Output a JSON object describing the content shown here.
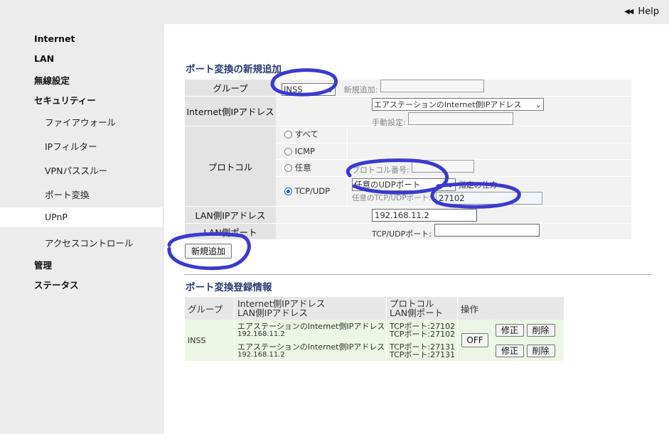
{
  "header": {
    "help_label": "Help",
    "help_arrows": "◀◀"
  },
  "sidebar": {
    "items": [
      {
        "label": "Internet"
      },
      {
        "label": "LAN"
      },
      {
        "label": "無線設定"
      },
      {
        "label": "セキュリティー"
      },
      {
        "label": "ファイアウォール"
      },
      {
        "label": "IPフィルター"
      },
      {
        "label": "VPNパススルー"
      },
      {
        "label": "ポート変換"
      },
      {
        "label": "UPnP"
      },
      {
        "label": "アクセスコントロール"
      },
      {
        "label": "管理"
      },
      {
        "label": "ステータス"
      }
    ]
  },
  "form": {
    "title": "ポート変換の新規追加",
    "group_label": "グループ",
    "group_value": "INSS",
    "new_add_label": "新規追加:",
    "internet_ip_label": "Internet側IPアドレス",
    "internet_ip_value": "エアステーションのInternet側IPアドレス",
    "manual_label": "手動設定:",
    "protocol_label": "プロトコル",
    "proto_all": "すべて",
    "proto_icmp": "ICMP",
    "proto_any": "任意",
    "proto_number_label": "プロトコル番号:",
    "proto_tcpudp": "TCP/UDP",
    "port_select_value": "任意のUDPポート",
    "port_specify_label": "指定の仕方",
    "any_port_label": "任意のTCP/UDPポート:",
    "any_port_value": "27102",
    "lan_ip_label": "LAN側IPアドレス",
    "lan_ip_value": "192.168.11.2",
    "lan_port_label": "LAN側ポート",
    "lan_port_sub": "TCP/UDPポート:",
    "lan_port_value": "",
    "add_button": "新規追加"
  },
  "registered": {
    "title": "ポート変換登録情報",
    "head_group": "グループ",
    "head_ip1": "Internet側IPアドレス",
    "head_ip2": "LAN側IPアドレス",
    "head_proto1": "プロトコル",
    "head_proto2": "LAN側ポート",
    "head_op": "操作",
    "group": "INSS",
    "off_button": "OFF",
    "entries": [
      {
        "ip_internet": "エアステーションのInternet側IPアドレス",
        "ip_lan": "192.168.11.2",
        "proto": "TCPポート:27102",
        "lan_port": "TCPポート:27102",
        "edit": "修正",
        "delete": "削除"
      },
      {
        "ip_internet": "エアステーションのInternet側IPアドレス",
        "ip_lan": "192.168.11.2",
        "proto": "TCPポート:27131",
        "lan_port": "TCPポート:27131",
        "edit": "修正",
        "delete": "削除"
      }
    ]
  },
  "colors": {
    "annotation": "#3a3ad0",
    "title": "#2a3b73",
    "radio": "#1a62d0"
  }
}
